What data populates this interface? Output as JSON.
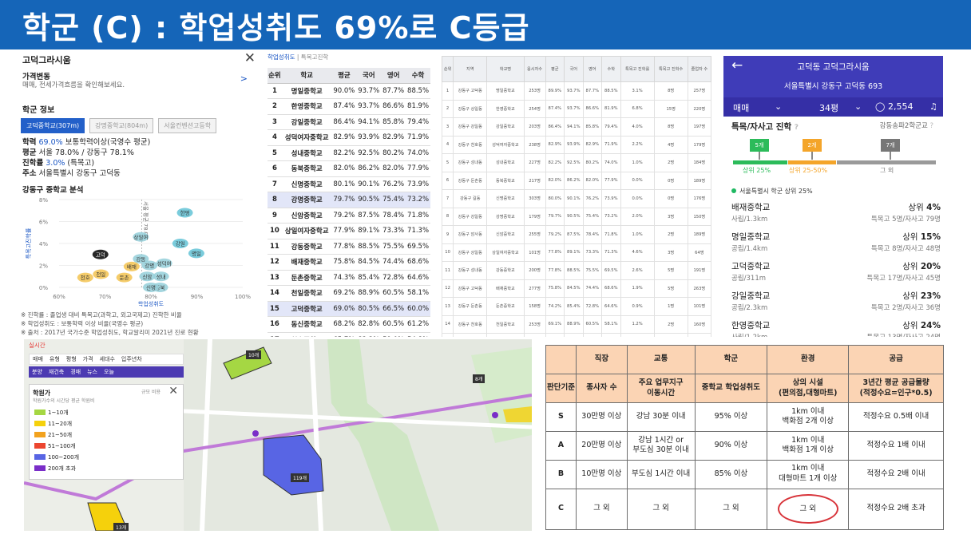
{
  "banner": {
    "title": "학군 (C) :  학업성취도  69%로  C등급"
  },
  "realestate": {
    "title": "고덕그라시움",
    "price_label": "가격변동",
    "price_sub": "매매, 전세가격흐름을 확인해보세요.",
    "school_section": "학군 정보",
    "tabs": [
      "고덕중학교(307m)",
      "강명중학교(804m)",
      "서울컨벤션고등학"
    ],
    "info": {
      "l1_label": "학력",
      "l1_value": "69.0%",
      "l1_rest": " 보통학력이상(국영수 평균)",
      "l2_label": "평균",
      "l2_rest": " 서울 78.0% / 강동구 78.1%",
      "l3_label": "진학률",
      "l3_value": "3.0%",
      "l3_rest": " (특목고)",
      "l4_label": "주소",
      "l4_rest": " 서울특별시 강동구 고덕동"
    },
    "analysis_title": "강동구 중학교 분석",
    "notes": [
      "※ 진학률 : 졸업생 대비 특목고(과학고, 외고국제고) 진학한 비율",
      "※ 학업성취도 : 보통학력 이상 비율(국영수 평균)",
      "※ 출처 : 2017년 국가수준 학업성취도, 학교알리미 2021년 진로 현황"
    ]
  },
  "ranking": {
    "header_a": "학업성취도",
    "header_b": "특목고진학",
    "columns": [
      "순위",
      "학교",
      "평균",
      "국어",
      "영어",
      "수학"
    ],
    "rows": [
      [
        "1",
        "명일중학교",
        "90.0%",
        "93.7%",
        "87.7%",
        "88.5%"
      ],
      [
        "2",
        "한영중학교",
        "87.4%",
        "93.7%",
        "86.6%",
        "81.9%"
      ],
      [
        "3",
        "강일중학교",
        "86.4%",
        "94.1%",
        "85.8%",
        "79.4%"
      ],
      [
        "4",
        "성덕여자중학교",
        "82.9%",
        "93.9%",
        "82.9%",
        "71.9%"
      ],
      [
        "5",
        "성내중학교",
        "82.2%",
        "92.5%",
        "80.2%",
        "74.0%"
      ],
      [
        "6",
        "동북중학교",
        "82.0%",
        "86.2%",
        "82.0%",
        "77.9%"
      ],
      [
        "7",
        "신명중학교",
        "80.1%",
        "90.1%",
        "76.2%",
        "73.9%"
      ],
      [
        "8",
        "강명중학교",
        "79.7%",
        "90.5%",
        "75.4%",
        "73.2%"
      ],
      [
        "9",
        "신암중학교",
        "79.2%",
        "87.5%",
        "78.4%",
        "71.8%"
      ],
      [
        "10",
        "상일여자중학교",
        "77.9%",
        "89.1%",
        "73.3%",
        "71.3%"
      ],
      [
        "11",
        "강동중학교",
        "77.8%",
        "88.5%",
        "75.5%",
        "69.5%"
      ],
      [
        "12",
        "배재중학교",
        "75.8%",
        "84.5%",
        "74.4%",
        "68.6%"
      ],
      [
        "13",
        "둔촌중학교",
        "74.3%",
        "85.4%",
        "72.8%",
        "64.6%"
      ],
      [
        "14",
        "천일중학교",
        "69.2%",
        "88.9%",
        "60.5%",
        "58.1%"
      ],
      [
        "15",
        "고덕중학교",
        "69.0%",
        "80.5%",
        "66.5%",
        "60.0%"
      ],
      [
        "16",
        "동신중학교",
        "68.2%",
        "82.8%",
        "60.5%",
        "61.2%"
      ],
      [
        "17",
        "천호중학교",
        "65.7%",
        "83.3%",
        "59.0%",
        "54.8%"
      ]
    ]
  },
  "detail": {
    "columns": [
      "순위",
      "지역",
      "학교명",
      "응시자수",
      "평균",
      "국어",
      "영어",
      "수학",
      "특목고 진학률",
      "특목고 진학수",
      "졸업자 수"
    ],
    "rows": [
      [
        "1",
        "강동구 고덕동",
        "명일중학교",
        "253명",
        "89.9%",
        "93.7%",
        "87.7%",
        "88.5%",
        "3.1%",
        "8명",
        "257명"
      ],
      [
        "2",
        "강동구 상일동",
        "한영중학교",
        "254명",
        "87.4%",
        "93.7%",
        "86.6%",
        "81.9%",
        "6.8%",
        "15명",
        "220명"
      ],
      [
        "3",
        "강동구 강일동",
        "강일중학교",
        "203명",
        "86.4%",
        "94.1%",
        "85.8%",
        "79.4%",
        "4.0%",
        "8명",
        "197명"
      ],
      [
        "4",
        "강동구 천호동",
        "성덕여자중학교",
        "238명",
        "82.9%",
        "93.9%",
        "82.9%",
        "71.9%",
        "2.2%",
        "4명",
        "179명"
      ],
      [
        "5",
        "강동구 성내동",
        "성내중학교",
        "227명",
        "82.2%",
        "92.5%",
        "80.2%",
        "74.0%",
        "1.0%",
        "2명",
        "184명"
      ],
      [
        "6",
        "강동구 둔촌동",
        "동북중학교",
        "217명",
        "82.0%",
        "86.2%",
        "82.0%",
        "77.9%",
        "0.0%",
        "0명",
        "189명"
      ],
      [
        "7",
        "강동구 길동",
        "신명중학교",
        "303명",
        "80.0%",
        "90.1%",
        "76.2%",
        "73.9%",
        "0.0%",
        "0명",
        "176명"
      ],
      [
        "8",
        "강동구 강일동",
        "강명중학교",
        "179명",
        "79.7%",
        "90.5%",
        "75.4%",
        "73.2%",
        "2.0%",
        "3명",
        "150명"
      ],
      [
        "9",
        "강동구 암사동",
        "신암중학교",
        "255명",
        "79.2%",
        "87.5%",
        "78.4%",
        "71.8%",
        "1.0%",
        "2명",
        "189명"
      ],
      [
        "10",
        "강동구 상일동",
        "상일여자중학교",
        "101명",
        "77.8%",
        "89.1%",
        "73.3%",
        "71.3%",
        "4.6%",
        "3명",
        "64명"
      ],
      [
        "11",
        "강동구 성내동",
        "강동중학교",
        "200명",
        "77.8%",
        "88.5%",
        "75.5%",
        "69.5%",
        "2.6%",
        "5명",
        "191명"
      ],
      [
        "12",
        "강동구 고덕동",
        "배재중학교",
        "277명",
        "75.8%",
        "84.5%",
        "74.4%",
        "68.6%",
        "1.9%",
        "5명",
        "263명"
      ],
      [
        "13",
        "강동구 둔촌동",
        "둔촌중학교",
        "158명",
        "74.2%",
        "85.4%",
        "72.8%",
        "64.6%",
        "0.9%",
        "1명",
        "101명"
      ],
      [
        "14",
        "강동구 천호동",
        "천일중학교",
        "253명",
        "69.1%",
        "88.9%",
        "60.5%",
        "58.1%",
        "1.2%",
        "2명",
        "160명"
      ],
      [
        "15",
        "강동구 고덕동",
        "고덕중학교",
        "188명",
        "69.0%",
        "80.5%",
        "66.5%",
        "60.0%",
        "3.0%",
        "5명",
        "165명"
      ]
    ]
  },
  "mobile": {
    "title": "고덕동 고덕그라시움",
    "address": "서울특별시 강동구 고덕동 693",
    "tab_trade": "매매",
    "tab_size": "34평",
    "comments": "2,554",
    "section": "특목/자사고 진학",
    "section_right": "강동송파2학군교",
    "flags": [
      "5개",
      "2개",
      "7개"
    ],
    "tiers": [
      "상위 25%",
      "상위 25-50%",
      "그 외"
    ],
    "region_line": "서울특별시 학군 상위 25%",
    "schools": [
      {
        "name": "배재중학교",
        "sub": "사립/1.3km",
        "rank_label": "상위",
        "rank": "4%",
        "detail": "특목고 5명/자사고 79명"
      },
      {
        "name": "명일중학교",
        "sub": "공립/1.4km",
        "rank_label": "상위",
        "rank": "15%",
        "detail": "특목고 8명/자사고 48명"
      },
      {
        "name": "고덕중학교",
        "sub": "공립/311m",
        "rank_label": "상위",
        "rank": "20%",
        "detail": "특목고 17명/자사고 45명"
      },
      {
        "name": "강일중학교",
        "sub": "공립/2.3km",
        "rank_label": "상위",
        "rank": "23%",
        "detail": "특목고 2명/자사고 36명"
      },
      {
        "name": "한영중학교",
        "sub": "사립/1.2km",
        "rank_label": "상위",
        "rank": "24%",
        "detail": "특목고 13명/자사고 24명"
      }
    ]
  },
  "map": {
    "header": "실시간",
    "toolbar1": [
      "매매",
      "유형",
      "평형",
      "가격",
      "세대수",
      "입주년차"
    ],
    "toolbar2": [
      "분양",
      "재건축",
      "경매",
      "뉴스",
      "오늘"
    ],
    "legend_title": "학원가",
    "legend_sub": "학원가수의 시간당 평균 학원비",
    "legend_btns": "규모  비용",
    "legend": [
      {
        "label": "1~10개",
        "color": "#a5d743"
      },
      {
        "label": "11~20개",
        "color": "#f5d10c"
      },
      {
        "label": "21~50개",
        "color": "#f2a21e"
      },
      {
        "label": "51~100개",
        "color": "#ec4630"
      },
      {
        "label": "100~200개",
        "color": "#5865e4"
      },
      {
        "label": "200개 초과",
        "color": "#7a2ec8"
      }
    ],
    "labels": [
      "10개",
      "8개",
      "119개",
      "13개"
    ]
  },
  "criteria": {
    "headers": [
      "",
      "직장",
      "교통",
      "학군",
      "환경",
      "공급"
    ],
    "criteria_row": [
      "판단기준",
      "종사자 수",
      "주요 업무지구\n이동시간",
      "중학교 학업성취도",
      "상의 시설\n(편의점,대형마트)",
      "3년간 평균 공급물량\n(적정수요=인구*0.5)"
    ],
    "rows": [
      [
        "S",
        "30만명 이상",
        "강남 30분 이내",
        "95% 이상",
        "1km 이내\n백화점 2개 이상",
        "적정수요 0.5배 이내"
      ],
      [
        "A",
        "20만명 이상",
        "강남 1시간 or\n부도심 30분 이내",
        "90% 이상",
        "1km 이내\n백화점 1개 이상",
        "적정수요 1배 이내"
      ],
      [
        "B",
        "10만명 이상",
        "부도심 1시간 이내",
        "85% 이상",
        "1km 이내\n대형마트 1개 이상",
        "적정수요 2배 이내"
      ],
      [
        "C",
        "그 외",
        "그 외",
        "그 외",
        "그 외",
        "적정수요 2배 초과"
      ]
    ]
  },
  "chart_data": {
    "type": "scatter",
    "title": "",
    "xlabel": "학업성취도",
    "ylabel": "특목고진학률",
    "xlim": [
      60,
      100
    ],
    "ylim": [
      0,
      8
    ],
    "xticks": [
      "60%",
      "70%",
      "80%",
      "90%",
      "100%"
    ],
    "yticks": [
      "0%",
      "2%",
      "4%",
      "6%",
      "8%"
    ],
    "points": [
      {
        "name": "한영",
        "x": 87.4,
        "y": 6.8,
        "color": "#6cc6d8"
      },
      {
        "name": "명일",
        "x": 89.9,
        "y": 3.1,
        "color": "#6cc6d8"
      },
      {
        "name": "강일",
        "x": 86.4,
        "y": 4.0,
        "color": "#6cc6d8"
      },
      {
        "name": "상일여",
        "x": 77.8,
        "y": 4.6,
        "color": "#9ad1dc"
      },
      {
        "name": "고덕",
        "x": 69.0,
        "y": 3.0,
        "color": "#111111"
      },
      {
        "name": "강동",
        "x": 77.8,
        "y": 2.6,
        "color": "#9ad1dc"
      },
      {
        "name": "성덕여",
        "x": 82.9,
        "y": 2.2,
        "color": "#9ad1dc"
      },
      {
        "name": "강명",
        "x": 79.7,
        "y": 2.0,
        "color": "#9ad1dc"
      },
      {
        "name": "배재",
        "x": 75.8,
        "y": 1.9,
        "color": "#f4c75a"
      },
      {
        "name": "천일",
        "x": 69.1,
        "y": 1.2,
        "color": "#f4c75a"
      },
      {
        "name": "신암",
        "x": 79.2,
        "y": 1.0,
        "color": "#9ad1dc"
      },
      {
        "name": "성내",
        "x": 82.2,
        "y": 1.0,
        "color": "#9ad1dc"
      },
      {
        "name": "둔촌",
        "x": 74.2,
        "y": 0.9,
        "color": "#f4c75a"
      },
      {
        "name": "천호",
        "x": 65.7,
        "y": 0.9,
        "color": "#f4c75a"
      },
      {
        "name": "동북",
        "x": 82.0,
        "y": 0.0,
        "color": "#9ad1dc"
      },
      {
        "name": "신명",
        "x": 80.0,
        "y": 0.0,
        "color": "#9ad1dc"
      }
    ],
    "ref_label": "서울 평균 78.0%",
    "ref_x": 78.0
  }
}
